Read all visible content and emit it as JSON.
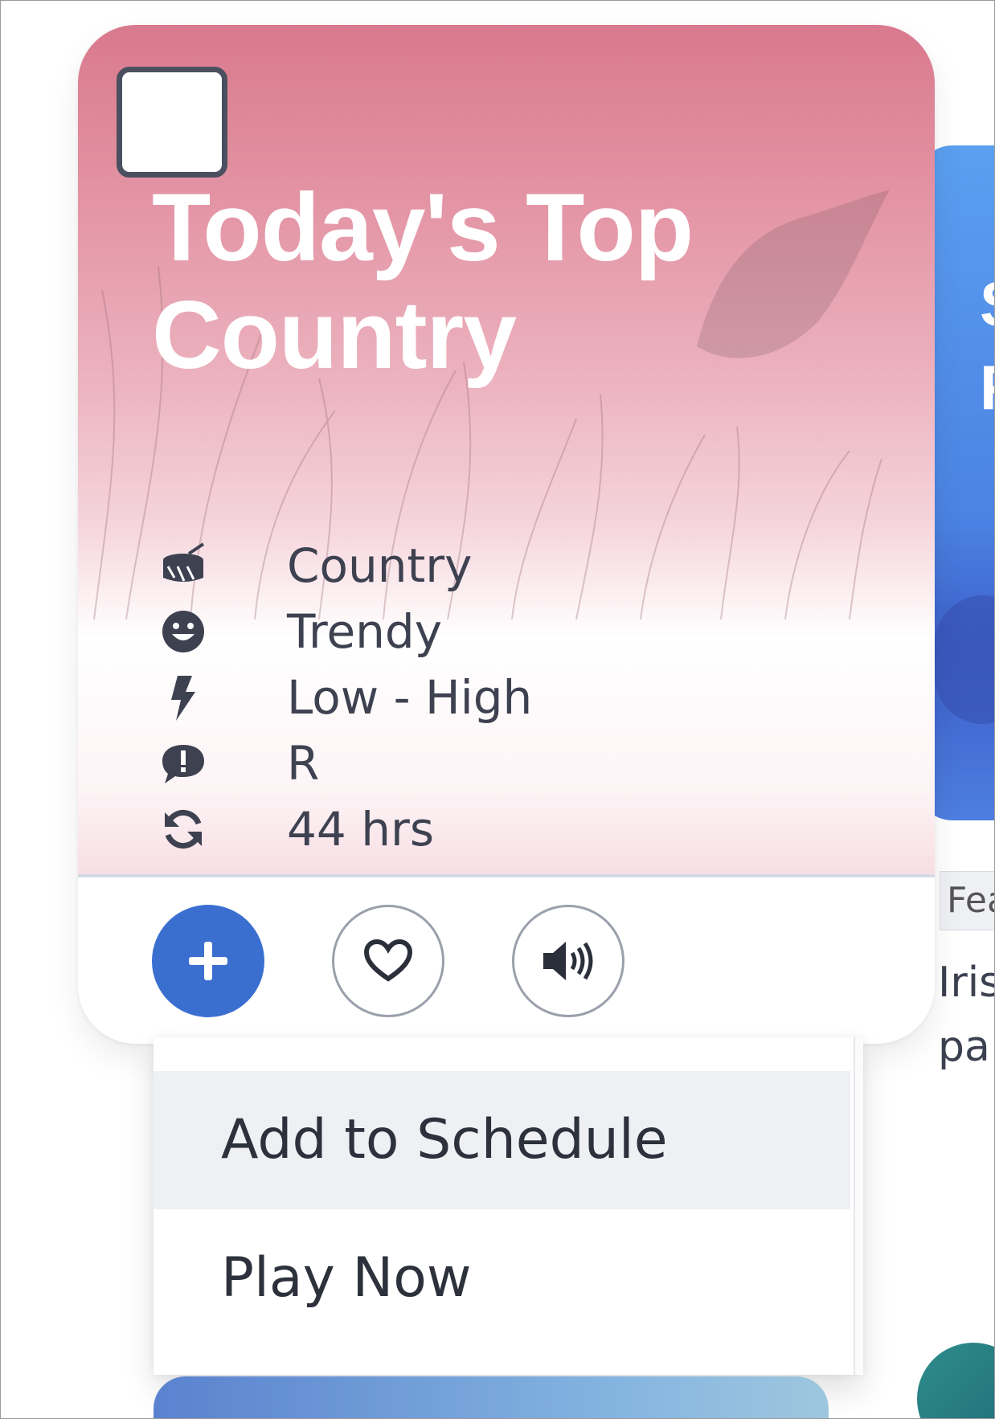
{
  "card": {
    "title": "Today's Top Country",
    "meta": [
      {
        "icon": "drum-icon",
        "label": "Country"
      },
      {
        "icon": "smile-icon",
        "label": "Trendy"
      },
      {
        "icon": "bolt-icon",
        "label": "Low - High"
      },
      {
        "icon": "explicit-comment-icon",
        "label": "R"
      },
      {
        "icon": "refresh-icon",
        "label": "44 hrs"
      }
    ],
    "actions": {
      "add_icon": "plus-icon",
      "favorite_icon": "heart-icon",
      "preview_icon": "volume-icon"
    }
  },
  "menu": {
    "items": [
      "Add to Schedule",
      "Play Now"
    ]
  },
  "next_card": {
    "peek_text": "S\nF",
    "label": "Fea",
    "description": "Iris\npa"
  },
  "colors": {
    "accent": "#3a6fd0",
    "card_top": "#d9798d",
    "text": "#3d4150"
  }
}
